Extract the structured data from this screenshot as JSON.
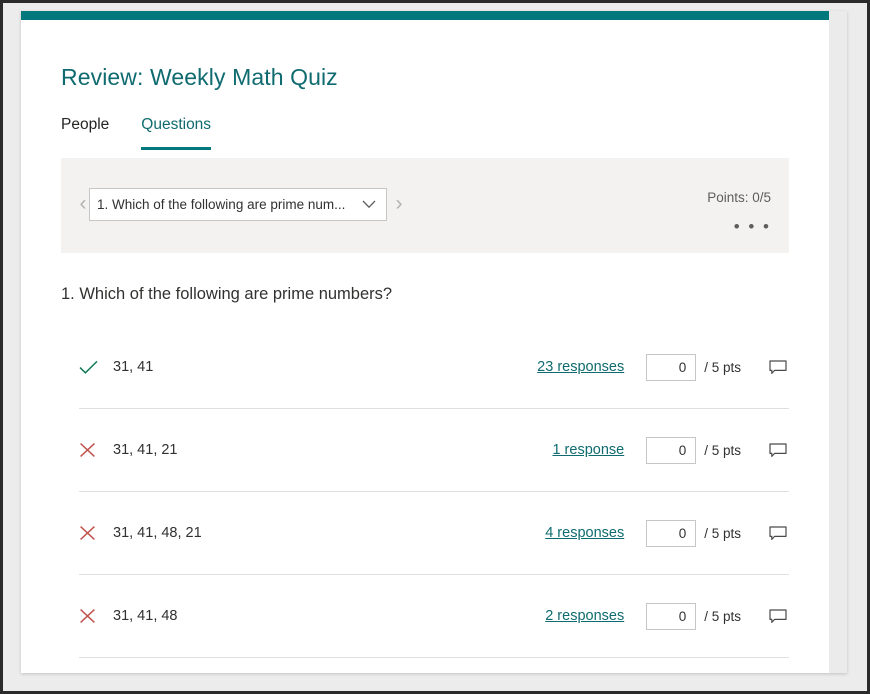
{
  "window": {
    "accent_color": "#03787c"
  },
  "header": {
    "title": "Review: Weekly Math Quiz"
  },
  "tabs": [
    {
      "label": "People",
      "active": false
    },
    {
      "label": "Questions",
      "active": true
    }
  ],
  "selector": {
    "prev_arrow": "‹",
    "next_arrow": "›",
    "selected_question": "1. Which of the following are prime num...",
    "caret_icon": "chevron-down-icon",
    "points_label": "Points: 0/5",
    "overflow_label": "• • •"
  },
  "question": {
    "text": "1. Which of the following are prime numbers?"
  },
  "answers": [
    {
      "mark": "correct",
      "label": "31, 41",
      "responses_link": "23 responses",
      "score_value": "0",
      "score_suffix": "/ 5 pts",
      "comment_icon": "comment-icon"
    },
    {
      "mark": "incorrect",
      "label": "31, 41, 21",
      "responses_link": "1 response",
      "score_value": "0",
      "score_suffix": "/ 5 pts",
      "comment_icon": "comment-icon"
    },
    {
      "mark": "incorrect",
      "label": "31, 41, 48, 21",
      "responses_link": "4 responses",
      "score_value": "0",
      "score_suffix": "/ 5 pts",
      "comment_icon": "comment-icon"
    },
    {
      "mark": "incorrect",
      "label": "31, 41, 48",
      "responses_link": "2 responses",
      "score_value": "0",
      "score_suffix": "/ 5 pts",
      "comment_icon": "comment-icon"
    }
  ],
  "colors": {
    "correct_mark": "#0f7b55",
    "incorrect_mark": "#c0534d",
    "link": "#0f6b6f",
    "accent": "#03787c"
  }
}
